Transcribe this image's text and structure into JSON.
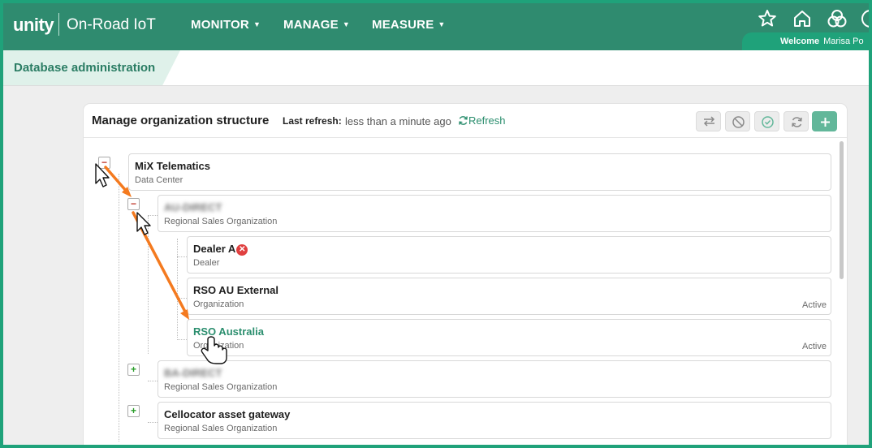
{
  "app": {
    "logo": "unity",
    "product": "On-Road IoT"
  },
  "nav": {
    "items": [
      {
        "label": "MONITOR"
      },
      {
        "label": "MANAGE"
      },
      {
        "label": "MEASURE"
      }
    ]
  },
  "header_icons": [
    "star-icon",
    "home-icon",
    "trefoil-icon"
  ],
  "user": {
    "welcome": "Welcome",
    "name": "Marisa Po"
  },
  "subheader": {
    "active_tab": "Database administration"
  },
  "panel": {
    "title": "Manage organization structure",
    "refresh_label": "Last refresh:",
    "refresh_value": "less than a minute ago",
    "refresh_link": "Refresh",
    "toolbar_icons": [
      "swap-icon",
      "block-icon",
      "check-circle-icon",
      "sync-icon",
      "plus-icon"
    ]
  },
  "tree": {
    "root": {
      "name": "MiX Telematics",
      "type": "Data Center",
      "expanded": true
    },
    "au_direct": {
      "name": "AU-DIRECT",
      "type": "Regional Sales Organization",
      "expanded": true
    },
    "dealer_a": {
      "name": "Dealer A",
      "type": "Dealer",
      "status": ""
    },
    "rso_au_external": {
      "name": "RSO AU External",
      "type": "Organization",
      "status": "Active"
    },
    "rso_australia": {
      "name": "RSO Australia",
      "type": "Organization",
      "status": "Active"
    },
    "ba_direct": {
      "name": "BA-DIRECT",
      "type": "Regional Sales Organization",
      "expanded": false
    },
    "cellocator": {
      "name": "Cellocator asset gateway",
      "type": "Regional Sales Organization",
      "expanded": false
    }
  },
  "colors": {
    "brand": "#2f8b6f",
    "accent": "#1fa27a",
    "link": "#2b8e6e",
    "annotation": "#f47a1f",
    "error": "#e04040"
  }
}
